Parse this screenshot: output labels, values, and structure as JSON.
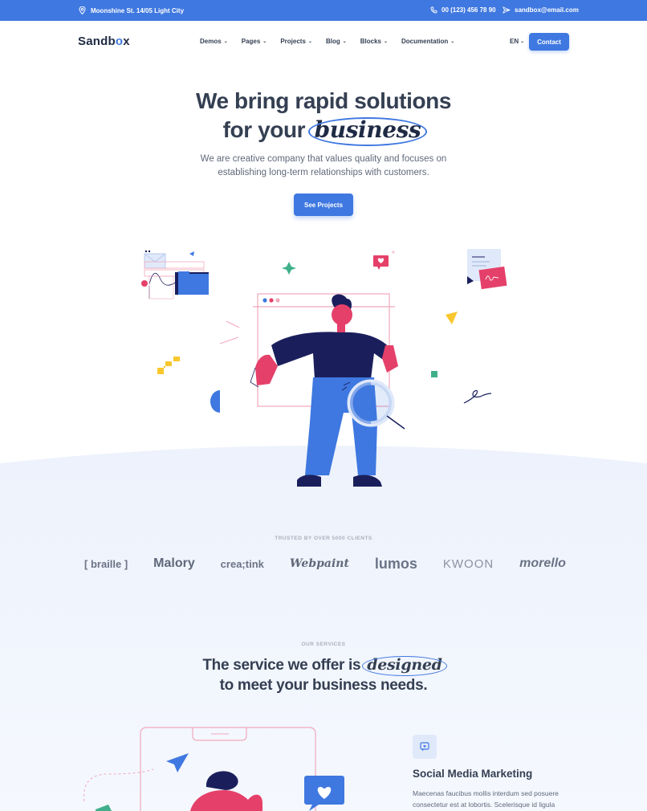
{
  "topbar": {
    "address": "Moonshine St. 14/05 Light City",
    "phone": "00 (123) 456 78 90",
    "email": "sandbox@email.com"
  },
  "nav": {
    "logo_a": "Sandb",
    "logo_o": "o",
    "logo_b": "x",
    "items": [
      "Demos",
      "Pages",
      "Projects",
      "Blog",
      "Blocks",
      "Documentation"
    ],
    "language": "EN",
    "contact": "Contact"
  },
  "hero": {
    "title_line1": "We bring rapid solutions",
    "title_line2_pre": "for your",
    "title_script": "business",
    "subtitle_line1": "We are creative company that values quality and focuses on",
    "subtitle_line2": "establishing long-term relationships with customers.",
    "button": "See Projects"
  },
  "clients": {
    "label": "TRUSTED BY OVER 5000 CLIENTS",
    "logos": [
      "[ braille ]",
      "Malory",
      "crea;tink",
      "Webpaint",
      "lumos",
      "KWOON",
      "morello"
    ]
  },
  "services": {
    "label": "OUR SERVICES",
    "title_pre": "The service we offer is",
    "title_script": "designed",
    "title_line2": "to meet your business needs.",
    "item": {
      "title": "Social Media Marketing",
      "text": "Maecenas faucibus mollis interdum sed posuere consectetur est at lobortis. Scelerisque id ligula"
    }
  },
  "colors": {
    "primary": "#3f78e0",
    "dark": "#343f52",
    "navy": "#1a1f5c",
    "pink": "#e5406a",
    "yellow": "#f8c72d",
    "mint": "#3fb08a"
  }
}
